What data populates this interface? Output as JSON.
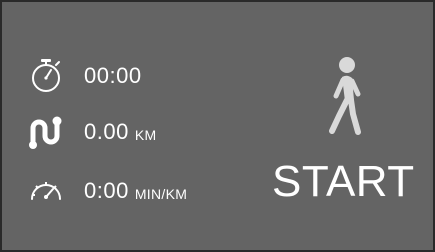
{
  "stats": {
    "time": {
      "value": "00:00",
      "icon": "stopwatch-icon"
    },
    "distance": {
      "value": "0.00",
      "unit": "KM",
      "icon": "route-icon"
    },
    "pace": {
      "value": "0:00",
      "unit": "MIN/KM",
      "icon": "speedometer-icon"
    }
  },
  "activity": {
    "icon": "walking-person-icon"
  },
  "start_button": {
    "label": "START"
  },
  "colors": {
    "background": "#646464",
    "border": "#2a2a2a",
    "foreground": "#ffffff",
    "walker": "#d9d9d9"
  }
}
